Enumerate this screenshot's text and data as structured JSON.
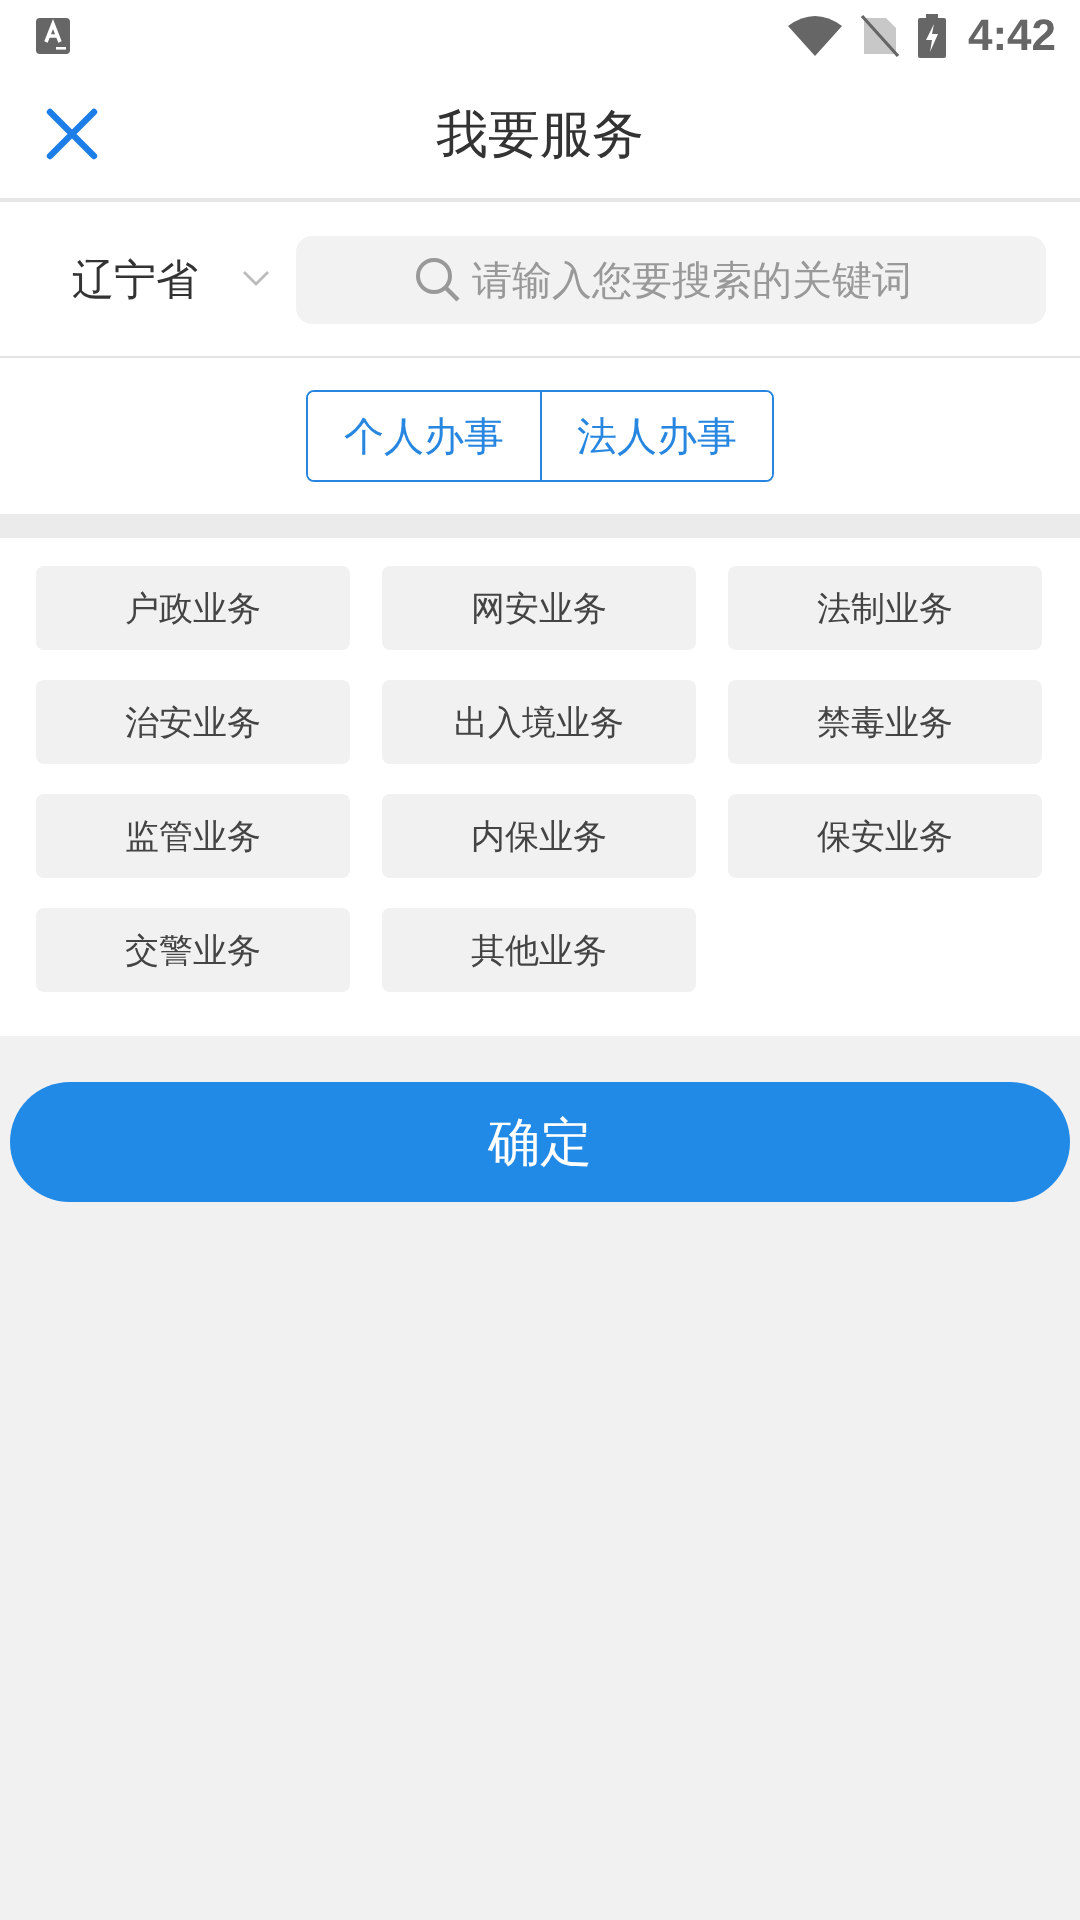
{
  "status_bar": {
    "time": "4:42"
  },
  "header": {
    "title": "我要服务"
  },
  "search": {
    "region": "辽宁省",
    "placeholder": "请输入您要搜索的关键词"
  },
  "tabs": [
    {
      "label": "个人办事"
    },
    {
      "label": "法人办事"
    }
  ],
  "services": [
    "户政业务",
    "网安业务",
    "法制业务",
    "治安业务",
    "出入境业务",
    "禁毒业务",
    "监管业务",
    "内保业务",
    "保安业务",
    "交警业务",
    "其他业务"
  ],
  "confirm_button": "确定"
}
